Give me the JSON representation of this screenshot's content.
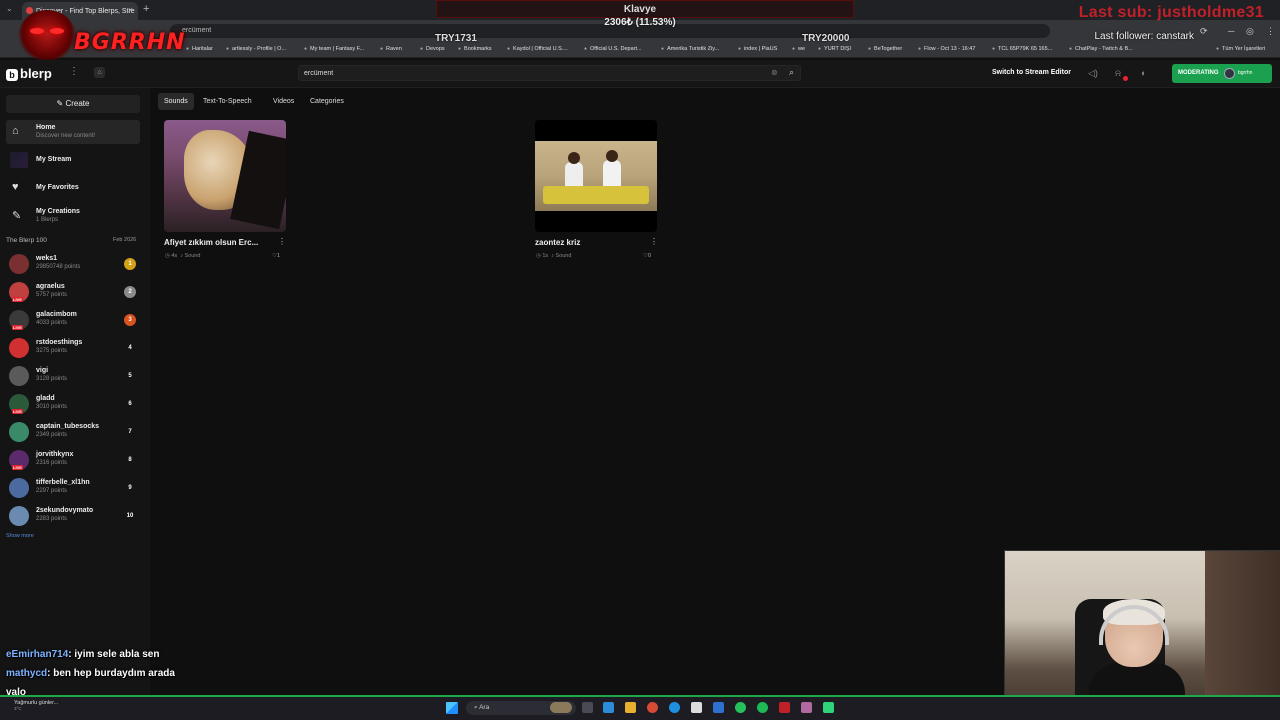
{
  "browser": {
    "tab_title": "Discover - Find Top Blerps, Stre",
    "address_hint": "ercüment",
    "bookmarks": [
      "Haritalar",
      "artlessly - Profile | O...",
      "My team | Fantasy F...",
      "Raven",
      "Devops",
      "Bookmarks",
      "Kaydol | Official U.S....",
      "Official U.S. Depart...",
      "Amerika Turistik Ziy...",
      "index | PiaUS",
      "we",
      "YURT DIŞI",
      "BeTogether",
      "Flow - Oct 13 - 16:47",
      "TCL 65P79K 65 165...",
      "ChatPlay - Twitch & B...",
      "Tüm Yer İşaretleri"
    ]
  },
  "overlay": {
    "brand": "BGRRHN",
    "klavye": "Klavye",
    "goal": "2306₺ (11.53%)",
    "try_left": "TRY1731",
    "try_right": "TRY20000",
    "last_sub": "Last sub: justholdme31",
    "last_follower": "Last follower: canstark"
  },
  "header": {
    "logo": "blerp",
    "search_value": "ercüment",
    "switch_label": "Switch to Stream Editor",
    "moderating_label": "MODERATING",
    "moderating_user": "bgrrhn"
  },
  "sidebar": {
    "create_label": "Create",
    "nav": [
      {
        "title": "Home",
        "subtitle": "Discover new content!"
      },
      {
        "title": "My Stream",
        "subtitle": ""
      },
      {
        "title": "My Favorites",
        "subtitle": ""
      },
      {
        "title": "My Creations",
        "subtitle": "1 Blerps"
      }
    ],
    "blerp100_label": "The Blerp 100",
    "blerp100_date": "Feb 2026",
    "ranking": [
      {
        "name": "weks1",
        "points": "29850748 points",
        "rank": "1",
        "color": "#d4a017"
      },
      {
        "name": "agraelus",
        "points": "5757 points",
        "rank": "2",
        "color": "#8a8a8a"
      },
      {
        "name": "galacimbom",
        "points": "4033 points",
        "rank": "3",
        "color": "#d9531e"
      },
      {
        "name": "rstdoesthings",
        "points": "3275 points",
        "rank": "4",
        "color": ""
      },
      {
        "name": "vigi",
        "points": "3128 points",
        "rank": "5",
        "color": ""
      },
      {
        "name": "gladd",
        "points": "3010 points",
        "rank": "6",
        "color": ""
      },
      {
        "name": "captain_tubesocks",
        "points": "2349 points",
        "rank": "7",
        "color": ""
      },
      {
        "name": "jorvithkynx",
        "points": "2316 points",
        "rank": "8",
        "color": ""
      },
      {
        "name": "tifferbelle_xl1hn",
        "points": "2297 points",
        "rank": "9",
        "color": ""
      },
      {
        "name": "2sekundovymato",
        "points": "2283 points",
        "rank": "10",
        "color": ""
      }
    ],
    "show_more": "Show more"
  },
  "main": {
    "tabs": [
      "Sounds",
      "Text-To-Speech",
      "Videos",
      "Categories"
    ],
    "cards": [
      {
        "title": "Afiyet zıkkım olsun Erc...",
        "duration": "4s",
        "type": "Sound",
        "likes": "1"
      },
      {
        "title": "zaontez kriz",
        "duration": "1s",
        "type": "Sound",
        "likes": "0"
      }
    ]
  },
  "chat": [
    {
      "user": "eEmirhan714",
      "message": "iyim sele abla sen"
    },
    {
      "user": "mathycd",
      "message": "ben hep burdaydım arada"
    },
    {
      "user": "",
      "message": "valo"
    }
  ],
  "taskbar": {
    "weather": "Yağmurlu günler...",
    "weather_temp": "3°C",
    "search": "Ara"
  }
}
